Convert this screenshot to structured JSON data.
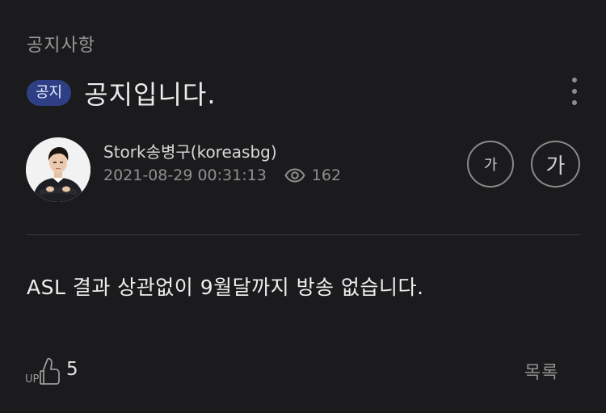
{
  "board": {
    "category": "공지사항"
  },
  "post": {
    "badge": "공지",
    "title": "공지입니다.",
    "author": "Stork송병구(koreasbg)",
    "datetime": "2021-08-29 00:31:13",
    "views": "162",
    "body": "ASL 결과 상관없이 9월달까지 방송 없습니다.",
    "up_count": "5"
  },
  "controls": {
    "font_small_label": "가",
    "font_large_label": "가",
    "list_label": "목록",
    "up_label": "UP"
  },
  "icons": {
    "more": "more-vertical-icon",
    "views": "eye-icon",
    "up": "thumbs-up-icon"
  },
  "colors": {
    "background": "#1b1b1d",
    "badge": "#2e3f86",
    "muted_text": "#8f8f8f",
    "divider": "#3a3a3c"
  }
}
